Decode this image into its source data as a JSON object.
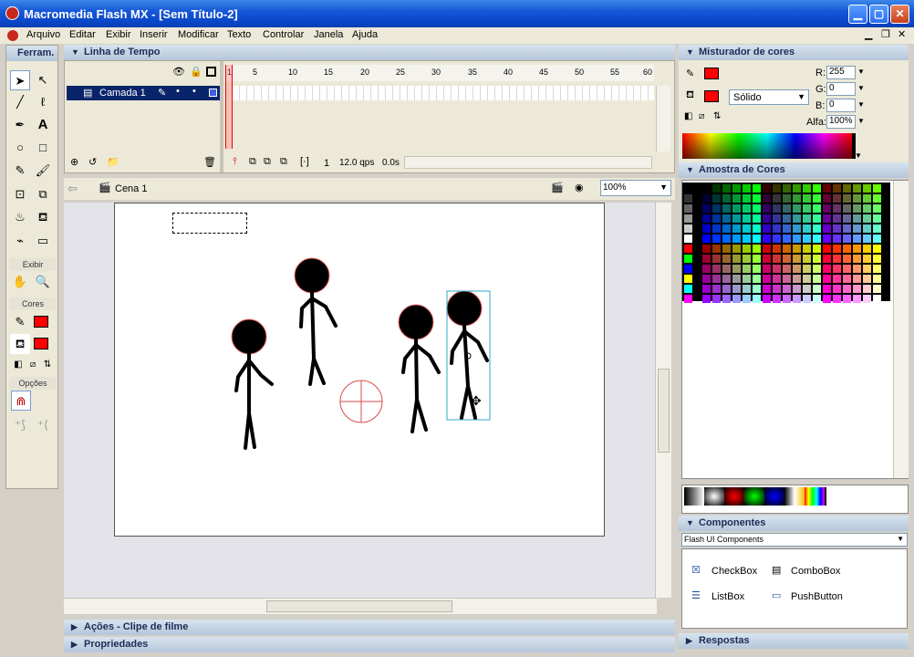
{
  "title": "Macromedia Flash MX - [Sem Título-2]",
  "menu": [
    "Arquivo",
    "Editar",
    "Exibir",
    "Inserir",
    "Modificar",
    "Texto",
    "Controlar",
    "Janela",
    "Ajuda"
  ],
  "toolbox": {
    "title": "Ferram.",
    "exibir": "Exibir",
    "cores": "Cores",
    "opcoes": "Opções"
  },
  "timeline": {
    "title": "Linha de Tempo",
    "layer": "Camada 1",
    "frames": [
      "1",
      "5",
      "10",
      "15",
      "20",
      "25",
      "30",
      "35",
      "40",
      "45",
      "50",
      "55",
      "60"
    ],
    "frame": "1",
    "fps": "12.0 qps",
    "time": "0.0s"
  },
  "scene": {
    "name": "Cena 1",
    "zoom": "100%"
  },
  "mixer": {
    "title": "Misturador de cores",
    "type": "Sólido",
    "r_label": "R:",
    "g_label": "G:",
    "b_label": "B:",
    "a_label": "Alfa:",
    "r": "255",
    "g": "0",
    "b": "0",
    "alpha": "100%"
  },
  "swatches": {
    "title": "Amostra de Cores"
  },
  "components": {
    "title": "Componentes",
    "set": "Flash UI Components",
    "items": [
      "CheckBox",
      "ComboBox",
      "ListBox",
      "PushButton"
    ]
  },
  "respostas": "Respostas",
  "acoes": "Ações - Clipe de filme",
  "propriedades": "Propriedades",
  "colors": {
    "accent": "#ff0000",
    "selection": "#2fa8c8"
  }
}
